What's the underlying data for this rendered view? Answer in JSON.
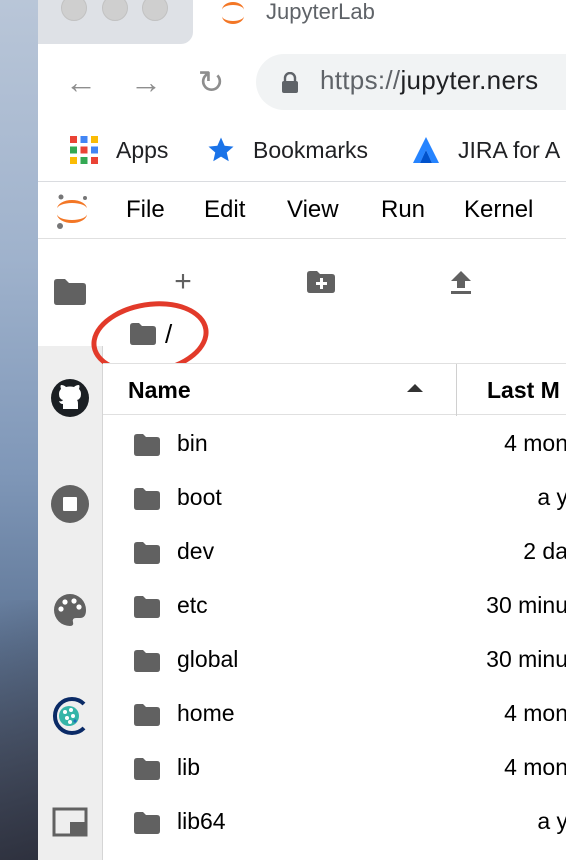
{
  "browser": {
    "tab_title": "JupyterLab",
    "url_scheme": "https://",
    "url_host": "jupyter.ners",
    "nav": {
      "back": "←",
      "forward": "→",
      "reload": "↻"
    }
  },
  "bookmarks": {
    "items": [
      {
        "label": "Apps",
        "icon": "apps-grid-icon"
      },
      {
        "label": "Bookmarks",
        "icon": "star-icon"
      },
      {
        "label": "JIRA for A",
        "icon": "jira-icon"
      }
    ]
  },
  "menubar": {
    "items": [
      "File",
      "Edit",
      "View",
      "Run",
      "Kernel"
    ]
  },
  "sidebar": {
    "icons": [
      "folder-icon",
      "github-icon",
      "stop-circle-icon",
      "palette-icon",
      "nersc-logo-icon",
      "tabs-icon"
    ]
  },
  "filebrowser": {
    "toolbar": {
      "new_launcher": "+",
      "new_folder": "new-folder-icon",
      "upload": "upload-icon"
    },
    "breadcrumb": "/",
    "columns": {
      "name": "Name",
      "modified": "Last M"
    },
    "files": [
      {
        "name": "bin",
        "modified": "4 mon"
      },
      {
        "name": "boot",
        "modified": "a y"
      },
      {
        "name": "dev",
        "modified": "2 da"
      },
      {
        "name": "etc",
        "modified": "30 minu"
      },
      {
        "name": "global",
        "modified": "30 minu"
      },
      {
        "name": "home",
        "modified": "4 mon"
      },
      {
        "name": "lib",
        "modified": "4 mon"
      },
      {
        "name": "lib64",
        "modified": "a y"
      }
    ]
  },
  "colors": {
    "jupyter_orange": "#F37726",
    "annotation_red": "#E23A2A",
    "bookmark_star": "#1A73E8",
    "jira_blue": "#2684FF",
    "icon_gray": "#616161"
  }
}
